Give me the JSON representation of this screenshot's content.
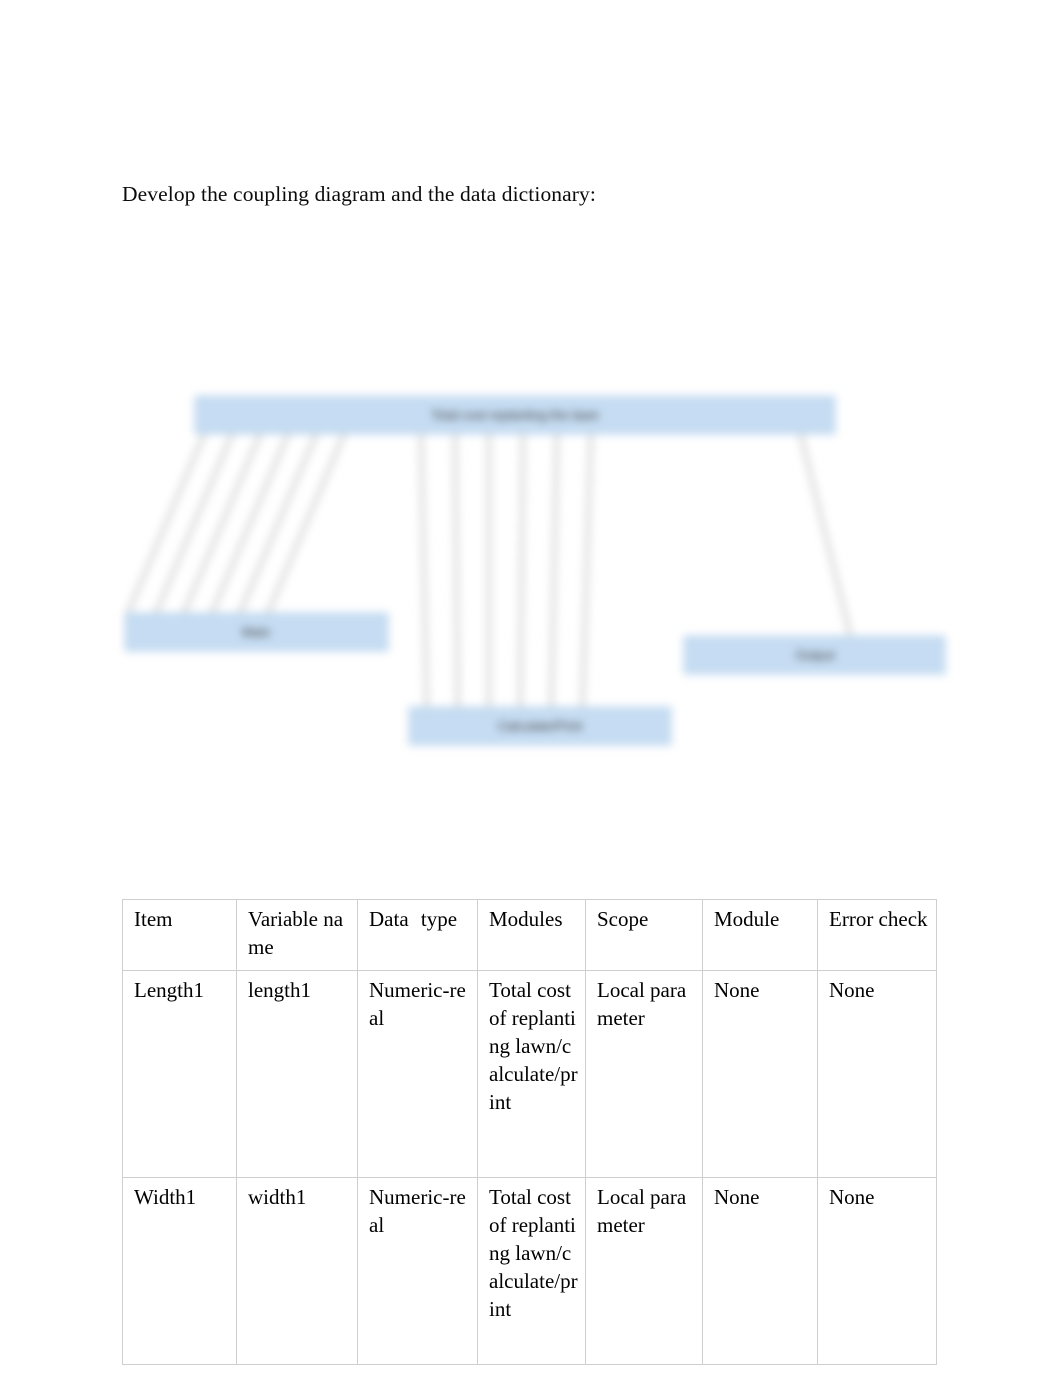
{
  "document": {
    "intro_text": "Develop the coupling diagram and the data dictionary:"
  },
  "diagram": {
    "name": "coupling-diagram",
    "blurred": true,
    "box_fill_color": "#c5dcf2",
    "box_border_color": "#b3cfe8",
    "connector_color": "#d9d9d9",
    "boxes": [
      {
        "id": "top",
        "label": "Total cost replanting the lawn"
      },
      {
        "id": "left",
        "label": "Main"
      },
      {
        "id": "bottom_center",
        "label": "Calculate/Print"
      },
      {
        "id": "right",
        "label": "Output"
      }
    ],
    "connector_groups": [
      {
        "from": "top",
        "to": "left",
        "count": 6
      },
      {
        "from": "top",
        "to": "bottom_center",
        "count": 6
      },
      {
        "from": "top",
        "to": "right",
        "count": 1
      }
    ]
  },
  "table": {
    "name": "data-dictionary",
    "headers": [
      "Item",
      "Variable name",
      "Data type",
      "Modules",
      "Scope",
      "Module",
      "Error check"
    ],
    "rows": [
      {
        "item": "Length1",
        "variable_name": "length1",
        "data_type": "Numeric-real",
        "modules": "Total cost of replanting lawn/calculate/print",
        "scope": "Local parameter",
        "module": "None",
        "error_check": "None"
      },
      {
        "item": "Width1",
        "variable_name": "width1",
        "data_type": "Numeric-real",
        "modules": "Total cost of replanting lawn/calculate/print",
        "scope": "Local parameter",
        "module": "None",
        "error_check": "None"
      }
    ]
  }
}
